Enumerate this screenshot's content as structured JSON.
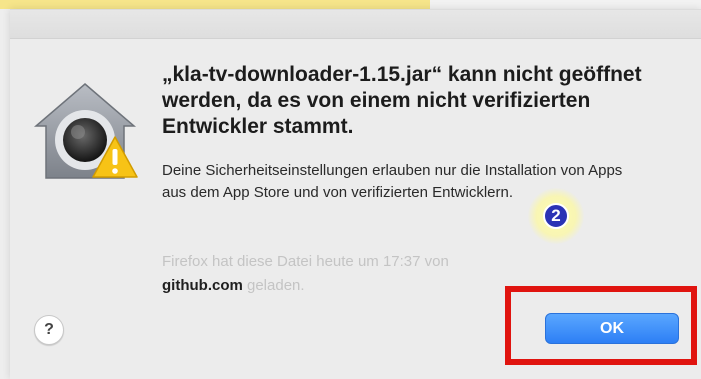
{
  "dialog": {
    "title": "„kla-tv-downloader-1.15.jar“ kann nicht geöffnet werden, da es von einem nicht verifizierten Entwickler stammt.",
    "message": "Deine Sicherheitseinstellungen erlauben nur die Installation von Apps aus dem App Store und von verifizierten Entwicklern.",
    "source_prefix": "Firefox hat diese Datei heute um 17:37 von",
    "source_domain": "github.com",
    "source_suffix": "geladen.",
    "help_label": "?",
    "ok_label": "OK",
    "icon": "gatekeeper-house-icon",
    "warning_icon": "warning-triangle-icon"
  },
  "annotation": {
    "step_number": "2",
    "highlight_color": "#e0140f",
    "badge_color": "#2b33b5"
  },
  "colors": {
    "accent": "#2d7ff5",
    "top_highlight": "#f6e58a"
  }
}
